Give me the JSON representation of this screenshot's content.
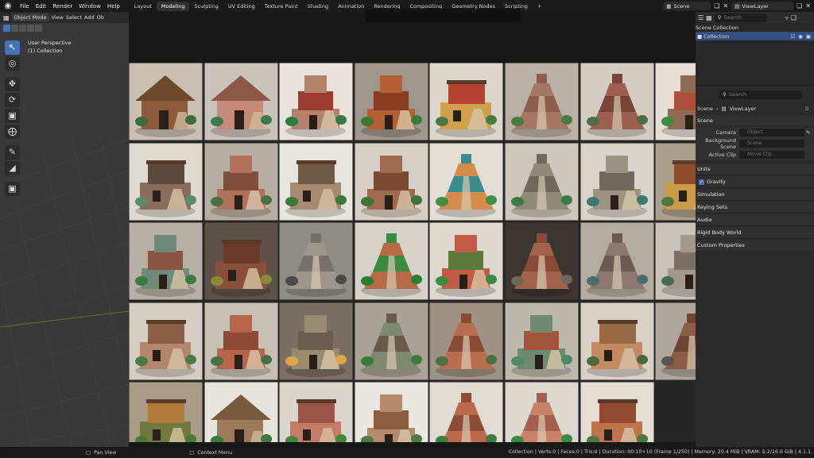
{
  "menubar": {
    "items": [
      "File",
      "Edit",
      "Render",
      "Window",
      "Help"
    ],
    "workspace_tabs": [
      "Layout",
      "Modeling",
      "Sculpting",
      "UV Editing",
      "Texture Paint",
      "Shading",
      "Animation",
      "Rendering",
      "Compositing",
      "Geometry Nodes",
      "Scripting"
    ],
    "active_tab": "Modeling",
    "add_tab": "+",
    "scene_label": "Scene",
    "view_layer_label": "ViewLayer"
  },
  "viewport": {
    "mode": "Object Mode",
    "menus": [
      "View",
      "Select",
      "Add",
      "Ob"
    ],
    "perspective": "User Perspective",
    "collection": "(1) Collection"
  },
  "outliner": {
    "search_placeholder": "Search",
    "rows": [
      "Scene Collection",
      "Collection"
    ]
  },
  "properties": {
    "search_placeholder": "Search",
    "breadcrumb": [
      "Scene",
      "ViewLayer"
    ],
    "section": "Scene",
    "fields": [
      {
        "label": "Camera",
        "placeholder": "Object"
      },
      {
        "label": "Background Scene",
        "placeholder": "Scene"
      },
      {
        "label": "Active Clip",
        "placeholder": "Movie Clip"
      }
    ],
    "panels": [
      "Units",
      "Gravity",
      "Simulation",
      "Keying Sets",
      "Audio",
      "Rigid Body World",
      "Custom Properties"
    ]
  },
  "statusbar": {
    "left": "Pan View",
    "middle": "Context Menu",
    "right": "Collection | Verts:0 | Faces:0 | Tris:0 | Duration: 00:10+10 (Frame 1/250) | Memory: 20.4 MiB | VRAM: 5.2/16.0 GiB | 4.1.1"
  },
  "gallery": {
    "description_colors": [
      "#c4b9a7",
      "#e8dfd4",
      "#d6cfc4",
      "#a89a86",
      "#e2d8c9",
      "#b5ad9f",
      "#c9c2b4",
      "#d0c8bb"
    ],
    "thumbnails": [
      {
        "bg": "#c8bfb1",
        "body": "#8a5a3a",
        "roof": "#6e4a2c",
        "accent": "#3c6b3a",
        "kind": "hut"
      },
      {
        "bg": "#c9c4bb",
        "body": "#c88a78",
        "roof": "#8e5848",
        "accent": "#3d7a4b",
        "kind": "hut"
      },
      {
        "bg": "#e7e3dc",
        "body": "#b4826a",
        "roof": "#9c3b2f",
        "accent": "#2f7a3e",
        "kind": "tower"
      },
      {
        "bg": "#9f978b",
        "body": "#b55f34",
        "roof": "#8a3c23",
        "accent": "#3c7a35",
        "kind": "tower"
      },
      {
        "bg": "#dcd6cc",
        "body": "#d1a04c",
        "roof": "#b5432f",
        "accent": "#4a7a43",
        "kind": "house"
      },
      {
        "bg": "#b9b1a6",
        "body": "#a57666",
        "roof": "#8d5d4e",
        "accent": "#4b7a41",
        "kind": "pyramid"
      },
      {
        "bg": "#d2ccc3",
        "body": "#9c5f52",
        "roof": "#7a4439",
        "accent": "#4f6e44",
        "kind": "pyramid"
      },
      {
        "bg": "#e5dfd6",
        "body": "#8d6b55",
        "roof": "#b0503a",
        "accent": "#3b8c3f",
        "kind": "tower"
      },
      {
        "bg": "#dfdad1",
        "body": "#8a6d5a",
        "roof": "#5e4a3d",
        "accent": "#5b8b6f",
        "kind": "house"
      },
      {
        "bg": "#b6aea2",
        "body": "#b0735a",
        "roof": "#7e4e3b",
        "accent": "#4c7040",
        "kind": "tower"
      },
      {
        "bg": "#e8e4de",
        "body": "#a58a6f",
        "roof": "#6f5a45",
        "accent": "#3c7a3b",
        "kind": "house"
      },
      {
        "bg": "#d6d0c6",
        "body": "#a06a4e",
        "roof": "#7c4a33",
        "accent": "#3c7537",
        "kind": "tower"
      },
      {
        "bg": "#e2ddd5",
        "body": "#d48c4a",
        "roof": "#3d8a8d",
        "accent": "#3f8f45",
        "kind": "pyramid"
      },
      {
        "bg": "#ccc6bc",
        "body": "#8e8a78",
        "roof": "#6d6a5a",
        "accent": "#3c7a45",
        "kind": "pyramid"
      },
      {
        "bg": "#d9d4cb",
        "body": "#9c9482",
        "roof": "#6f6a5c",
        "accent": "#3f7a70",
        "kind": "tower"
      },
      {
        "bg": "#ab9f8c",
        "body": "#c99a49",
        "roof": "#8e4c2d",
        "accent": "#4a7a3b",
        "kind": "house"
      },
      {
        "bg": "#b7b1a5",
        "body": "#6f8a78",
        "roof": "#8b5342",
        "accent": "#3c7a3f",
        "kind": "tower"
      },
      {
        "bg": "#5d5248",
        "body": "#8a4f3a",
        "roof": "#6b3929",
        "accent": "#8a8a3a",
        "kind": "house"
      },
      {
        "bg": "#8f8b85",
        "body": "#9d968a",
        "roof": "#76716a",
        "accent": "#4a4a4a",
        "kind": "pyramid"
      },
      {
        "bg": "#d6d2c9",
        "body": "#b56a45",
        "roof": "#3b8a3f",
        "accent": "#2f7d35",
        "kind": "pyramid"
      },
      {
        "bg": "#ddd8d0",
        "body": "#c05c43",
        "roof": "#5e7a3b",
        "accent": "#3d8b43",
        "kind": "tower"
      },
      {
        "bg": "#3c3632",
        "body": "#a3624a",
        "roof": "#8a4b36",
        "accent": "#6a6a5a",
        "kind": "pyramid"
      },
      {
        "bg": "#b2aca3",
        "body": "#8d7870",
        "roof": "#6d5a54",
        "accent": "#4d6d6d",
        "kind": "pyramid"
      },
      {
        "bg": "#c7c2ba",
        "body": "#a3988a",
        "roof": "#7a7064",
        "accent": "#4a6a5a",
        "kind": "tower"
      },
      {
        "bg": "#d4cec4",
        "body": "#b3866b",
        "roof": "#8a5f46",
        "accent": "#4a7a46",
        "kind": "house"
      },
      {
        "bg": "#c6bfb4",
        "body": "#b4654c",
        "roof": "#8e4a34",
        "accent": "#4b7040",
        "kind": "tower"
      },
      {
        "bg": "#7a6f63",
        "body": "#9a8a72",
        "roof": "#6b5e4e",
        "accent": "#e0a54a",
        "kind": "tower"
      },
      {
        "bg": "#a9a397",
        "body": "#7e8a6f",
        "roof": "#6a5a4a",
        "accent": "#3c7a3c",
        "kind": "pyramid"
      },
      {
        "bg": "#9d9284",
        "body": "#b86d4e",
        "roof": "#8b4a33",
        "accent": "#4d7040",
        "kind": "pyramid"
      },
      {
        "bg": "#bdb8ae",
        "body": "#6f8a70",
        "roof": "#a4543b",
        "accent": "#4a8a6a",
        "kind": "tower"
      },
      {
        "bg": "#d7d1c8",
        "body": "#c28a5e",
        "roof": "#9a6a45",
        "accent": "#4a6a3f",
        "kind": "house"
      },
      {
        "bg": "#ada79c",
        "body": "#8e5c4a",
        "roof": "#6e4535",
        "accent": "#555",
        "kind": "pyramid"
      },
      {
        "bg": "#a99d88",
        "body": "#6f7a3f",
        "roof": "#b07a3a",
        "accent": "#4a7a3a",
        "kind": "house"
      },
      {
        "bg": "#e7e3dd",
        "body": "#9c7a5a",
        "roof": "#7a5a3c",
        "accent": "#3d7a3e",
        "kind": "hut"
      },
      {
        "bg": "#dad5cd",
        "body": "#c77a66",
        "roof": "#9a5447",
        "accent": "#3f8a3f",
        "kind": "house"
      },
      {
        "bg": "#eae7e2",
        "body": "#b58a6a",
        "roof": "#8a5c40",
        "accent": "#4b7a44",
        "kind": "tower"
      },
      {
        "bg": "#e0dbd3",
        "body": "#bb6a4a",
        "roof": "#8e4b36",
        "accent": "#3f7d3f",
        "kind": "pyramid"
      },
      {
        "bg": "#ddd8d0",
        "body": "#c9826a",
        "roof": "#a4604c",
        "accent": "#3c8a40",
        "kind": "pyramid"
      },
      {
        "bg": "#e3ddd4",
        "body": "#c0744c",
        "roof": "#944a30",
        "accent": "#4a7a40",
        "kind": "house"
      }
    ]
  }
}
